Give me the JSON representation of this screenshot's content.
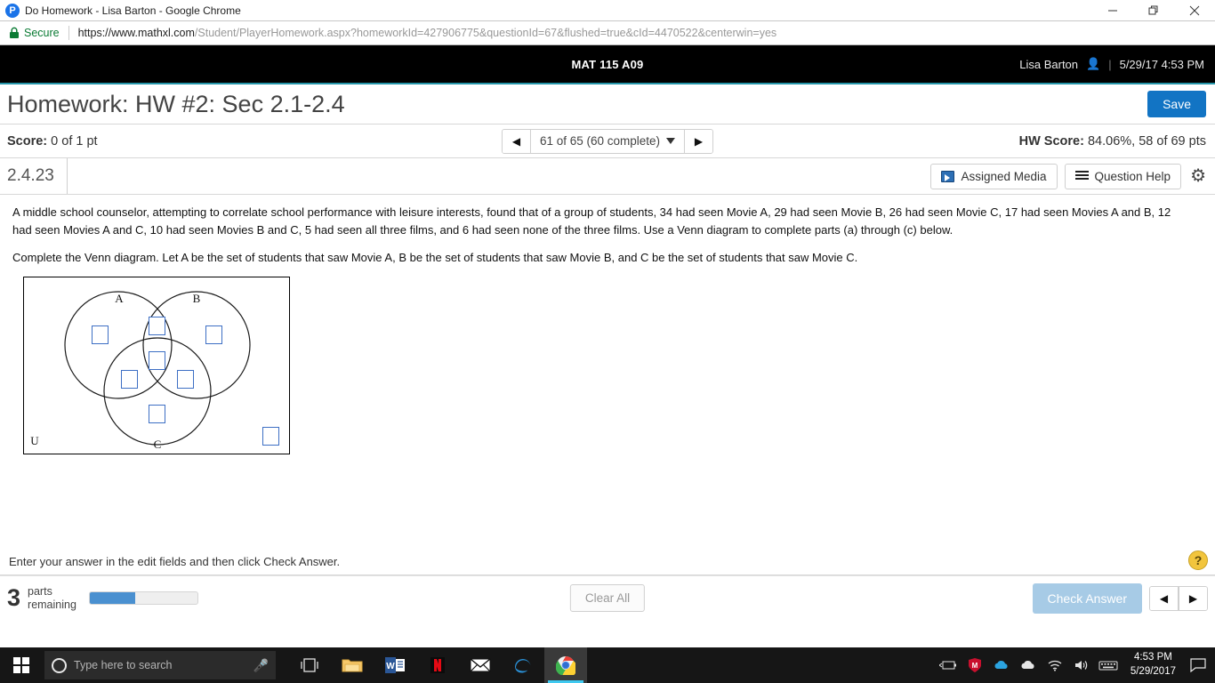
{
  "browser": {
    "window_title": "Do Homework - Lisa Barton - Google Chrome",
    "favicon_letter": "P",
    "security_label": "Secure",
    "url": "https://www.mathxl.com/Student/PlayerHomework.aspx?homeworkId=427906775&questionId=67&flushed=true&cId=4470522&centerwin=yes",
    "url_host": "https://www.mathxl.com",
    "url_path": "/Student/PlayerHomework.aspx?homeworkId=427906775&questionId=67&flushed=true&cId=4470522&centerwin=yes",
    "minimize_icon": "minimize-icon",
    "maximize_icon": "maximize-icon",
    "close_icon": "close-icon"
  },
  "mathxl_header": {
    "course": "MAT 115 A09",
    "user_name": "Lisa Barton",
    "separator": "|",
    "datetime": "5/29/17 4:53 PM"
  },
  "title_row": {
    "title": "Homework: HW #2: Sec 2.1-2.4",
    "save_label": "Save"
  },
  "score_row": {
    "score_label": "Score:",
    "score_value": "0 of 1 pt",
    "pager_label": "61 of 65 (60 complete)",
    "prev_arrow": "◀",
    "next_arrow": "▶",
    "hw_score_label": "HW Score:",
    "hw_score_value": "84.06%, 58 of 69 pts"
  },
  "exercise_row": {
    "number": "2.4.23",
    "assigned_media_label": "Assigned Media",
    "question_help_label": "Question Help",
    "gear_icon": "⚙"
  },
  "question": {
    "paragraph": "A middle school counselor, attempting to correlate school performance with leisure interests, found that of a group of students, 34 had seen Movie A, 29 had seen Movie B, 26 had seen Movie C, 17 had seen Movies A and B, 12 had seen Movies A and C, 10 had seen Movies B and C, 5 had seen all three films, and 6 had seen none of the three films. Use a Venn diagram to complete parts (a) through (c) below.",
    "instruction": "Complete the Venn diagram. Let A be the set of students that saw Movie A, B be the set of students that saw Movie B, and C be the set of students that saw Movie C."
  },
  "venn": {
    "label_a": "A",
    "label_b": "B",
    "label_c": "C",
    "label_u": "U",
    "field_count": 8,
    "fields": [
      {
        "name": "a-only",
        "value": ""
      },
      {
        "name": "a-and-b-only",
        "value": ""
      },
      {
        "name": "b-only",
        "value": ""
      },
      {
        "name": "a-b-c",
        "value": ""
      },
      {
        "name": "a-and-c-only",
        "value": ""
      },
      {
        "name": "b-and-c-only",
        "value": ""
      },
      {
        "name": "c-only",
        "value": ""
      },
      {
        "name": "outside-all",
        "value": ""
      }
    ]
  },
  "footer": {
    "hint": "Enter your answer in the edit fields and then click Check Answer.",
    "help_icon_label": "?",
    "parts_number": "3",
    "parts_label_line1": "parts",
    "parts_label_line2": "remaining",
    "progress_percent": 42,
    "clear_all_label": "Clear All",
    "check_answer_label": "Check Answer",
    "prev_arrow": "◀",
    "next_arrow": "▶"
  },
  "taskbar": {
    "search_placeholder": "Type here to search",
    "time": "4:53 PM",
    "date": "5/29/2017",
    "icons": [
      "task-view-icon",
      "file-explorer-icon",
      "word-icon",
      "netflix-icon",
      "mail-icon",
      "edge-icon",
      "chrome-icon"
    ],
    "tray_icons": [
      "battery-icon",
      "mcafee-icon",
      "onedrive-blue-icon",
      "onedrive-white-icon",
      "wifi-icon",
      "volume-icon",
      "keyboard-icon"
    ],
    "action_center_icon": "action-center-icon"
  },
  "colors": {
    "accent_blue": "#1274c4",
    "teal_rule": "#2596aa",
    "progress_blue": "#4a90d0",
    "check_answer_blue": "#a7cbe6",
    "venn_field_border": "#3d6fc4",
    "secure_green": "#0b7b34"
  }
}
